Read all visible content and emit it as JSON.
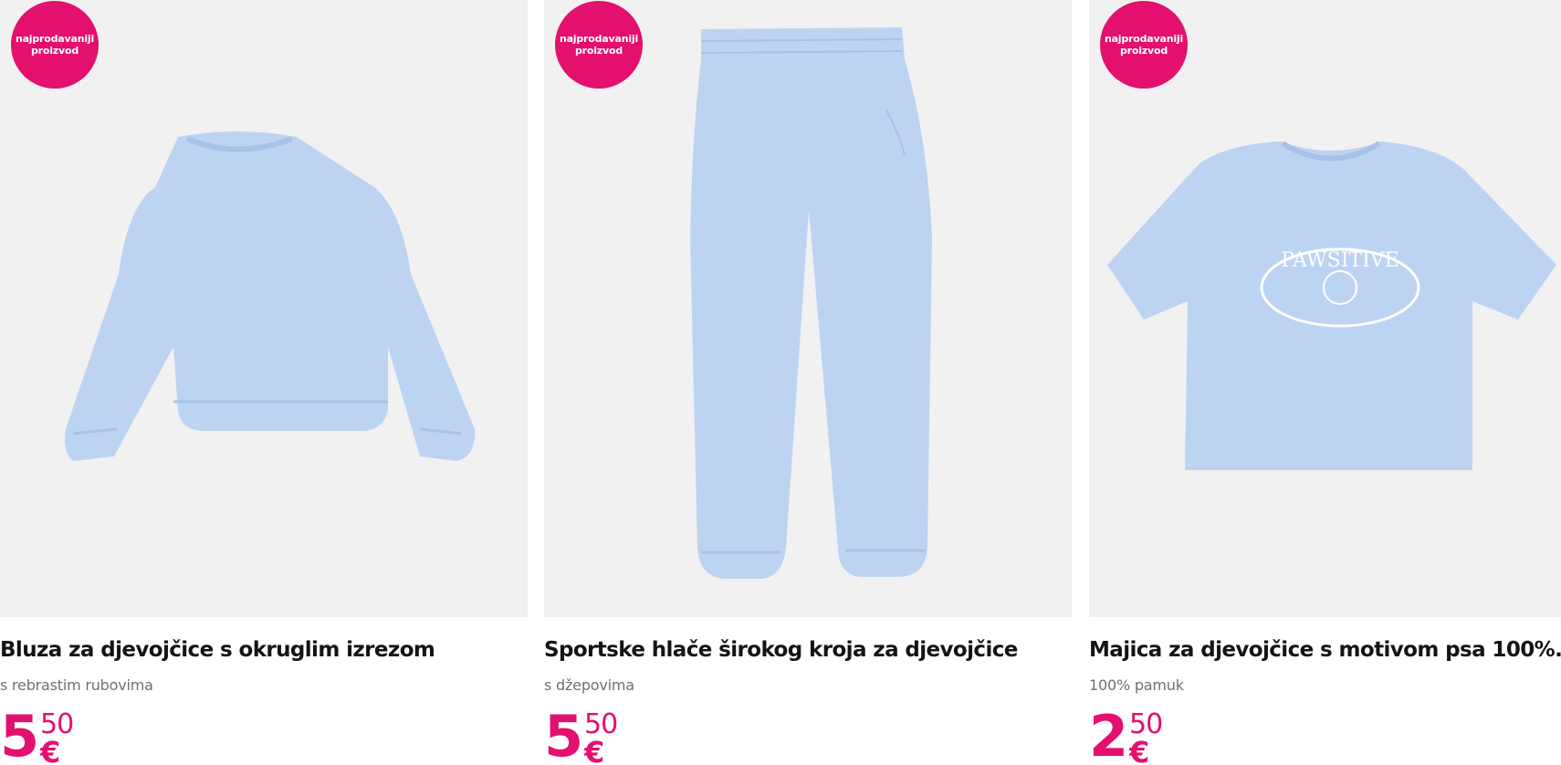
{
  "products": [
    {
      "badge": "najprodavaniji proizvod",
      "image_icon": "sweatshirt-image",
      "title": "Bluza za djevojčice s okruglim izrezom",
      "subtitle": "s rebrastim rubovima",
      "price_int": "5",
      "price_dec": "50",
      "currency": "€"
    },
    {
      "badge": "najprodavaniji proizvod",
      "image_icon": "joggers-image",
      "title": "Sportske hlače širokog kroja za djevojčice",
      "subtitle": "s džepovima",
      "price_int": "5",
      "price_dec": "50",
      "currency": "€"
    },
    {
      "badge": "najprodavaniji proizvod",
      "image_icon": "tshirt-image",
      "print_text": "PAWSITIVE",
      "title": "Majica za djevojčice s motivom psa 100%...",
      "subtitle": "100% pamuk",
      "price_int": "2",
      "price_dec": "50",
      "currency": "€"
    }
  ],
  "colors": {
    "accent": "#e3106e",
    "garment": "#bcd4f2",
    "image_bg": "#f1f1f1"
  }
}
